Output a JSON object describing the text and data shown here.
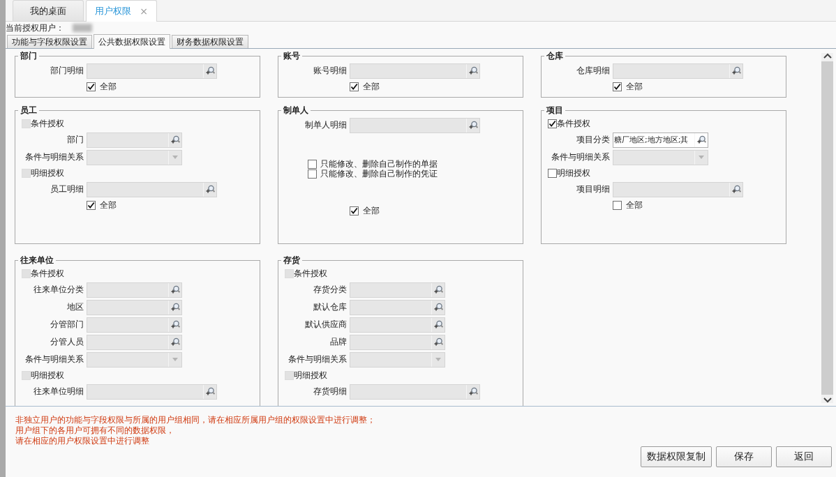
{
  "tabs": [
    {
      "label": "我的桌面",
      "selected": false
    },
    {
      "label": "用户权限",
      "selected": true,
      "close": "×"
    }
  ],
  "current_user": {
    "label": "当前授权用户："
  },
  "subtabs": [
    {
      "label": "功能与字段权限设置",
      "selected": false
    },
    {
      "label": "公共数据权限设置",
      "selected": true
    },
    {
      "label": "财务数据权限设置",
      "selected": false
    }
  ],
  "panels": [
    {
      "title": "部门",
      "rows": [
        {
          "kind": "detail",
          "label": "部门明细",
          "disabled": true
        },
        {
          "kind": "all",
          "label": "全部",
          "checked": true
        }
      ]
    },
    {
      "title": "账号",
      "rows": [
        {
          "kind": "detail",
          "label": "账号明细",
          "disabled": true
        },
        {
          "kind": "all",
          "label": "全部",
          "checked": true
        }
      ]
    },
    {
      "title": "仓库",
      "rows": [
        {
          "kind": "detail",
          "label": "仓库明细",
          "disabled": true
        },
        {
          "kind": "all",
          "label": "全部",
          "checked": true
        }
      ]
    },
    {
      "title": "员工",
      "rows": [
        {
          "kind": "condition",
          "label": "条件授权",
          "checked": false,
          "disabled": true
        },
        {
          "kind": "lookup",
          "label": "部门",
          "disabled": true
        },
        {
          "kind": "select",
          "label": "条件与明细关系",
          "disabled": true
        },
        {
          "kind": "condition",
          "label": "明细授权",
          "checked": false,
          "disabled": true
        },
        {
          "kind": "detail",
          "label": "员工明细",
          "disabled": true
        },
        {
          "kind": "all",
          "label": "全部",
          "checked": true
        }
      ]
    },
    {
      "title": "制单人",
      "rows": [
        {
          "kind": "detail",
          "label": "制单人明细",
          "disabled": true
        },
        {
          "kind": "option",
          "label": "只能修改、删除自己制作的单据",
          "checked": false
        },
        {
          "kind": "option",
          "label": "只能修改、删除自己制作的凭证",
          "checked": false
        },
        {
          "kind": "all",
          "label": "全部",
          "checked": true
        }
      ]
    },
    {
      "title": "项目",
      "rows": [
        {
          "kind": "condition",
          "label": "条件授权",
          "checked": true,
          "disabled": false
        },
        {
          "kind": "lookup",
          "label": "项目分类",
          "disabled": false,
          "value": "糖厂地区;地方地区;其"
        },
        {
          "kind": "select",
          "label": "条件与明细关系",
          "disabled": true
        },
        {
          "kind": "condition",
          "label": "明细授权",
          "checked": false,
          "disabled": false
        },
        {
          "kind": "detail",
          "label": "项目明细",
          "disabled": true
        },
        {
          "kind": "all",
          "label": "全部",
          "checked": false
        }
      ]
    },
    {
      "title": "往来单位",
      "rows": [
        {
          "kind": "condition",
          "label": "条件授权",
          "checked": false,
          "disabled": true
        },
        {
          "kind": "lookup",
          "label": "往来单位分类",
          "disabled": true
        },
        {
          "kind": "lookup",
          "label": "地区",
          "disabled": true
        },
        {
          "kind": "lookup",
          "label": "分管部门",
          "disabled": true
        },
        {
          "kind": "lookup",
          "label": "分管人员",
          "disabled": true
        },
        {
          "kind": "select",
          "label": "条件与明细关系",
          "disabled": true
        },
        {
          "kind": "condition",
          "label": "明细授权",
          "checked": false,
          "disabled": true
        },
        {
          "kind": "detail",
          "label": "往来单位明细",
          "disabled": true
        }
      ]
    },
    {
      "title": "存货",
      "rows": [
        {
          "kind": "condition",
          "label": "条件授权",
          "checked": false,
          "disabled": true
        },
        {
          "kind": "lookup",
          "label": "存货分类",
          "disabled": true
        },
        {
          "kind": "lookup",
          "label": "默认仓库",
          "disabled": true
        },
        {
          "kind": "lookup",
          "label": "默认供应商",
          "disabled": true
        },
        {
          "kind": "lookup",
          "label": "品牌",
          "disabled": true
        },
        {
          "kind": "select",
          "label": "条件与明细关系",
          "disabled": true
        },
        {
          "kind": "condition",
          "label": "明细授权",
          "checked": false,
          "disabled": true
        },
        {
          "kind": "detail",
          "label": "存货明细",
          "disabled": true
        }
      ]
    }
  ],
  "notice": [
    "非独立用户的功能与字段权限与所属的用户组相同，请在相应所属用户组的权限设置中进行调整；",
    "用户组下的各用户可拥有不同的数据权限，",
    "请在相应的用户权限设置中进行调整"
  ],
  "buttons": [
    "数据权限复制",
    "保存",
    "返回"
  ]
}
